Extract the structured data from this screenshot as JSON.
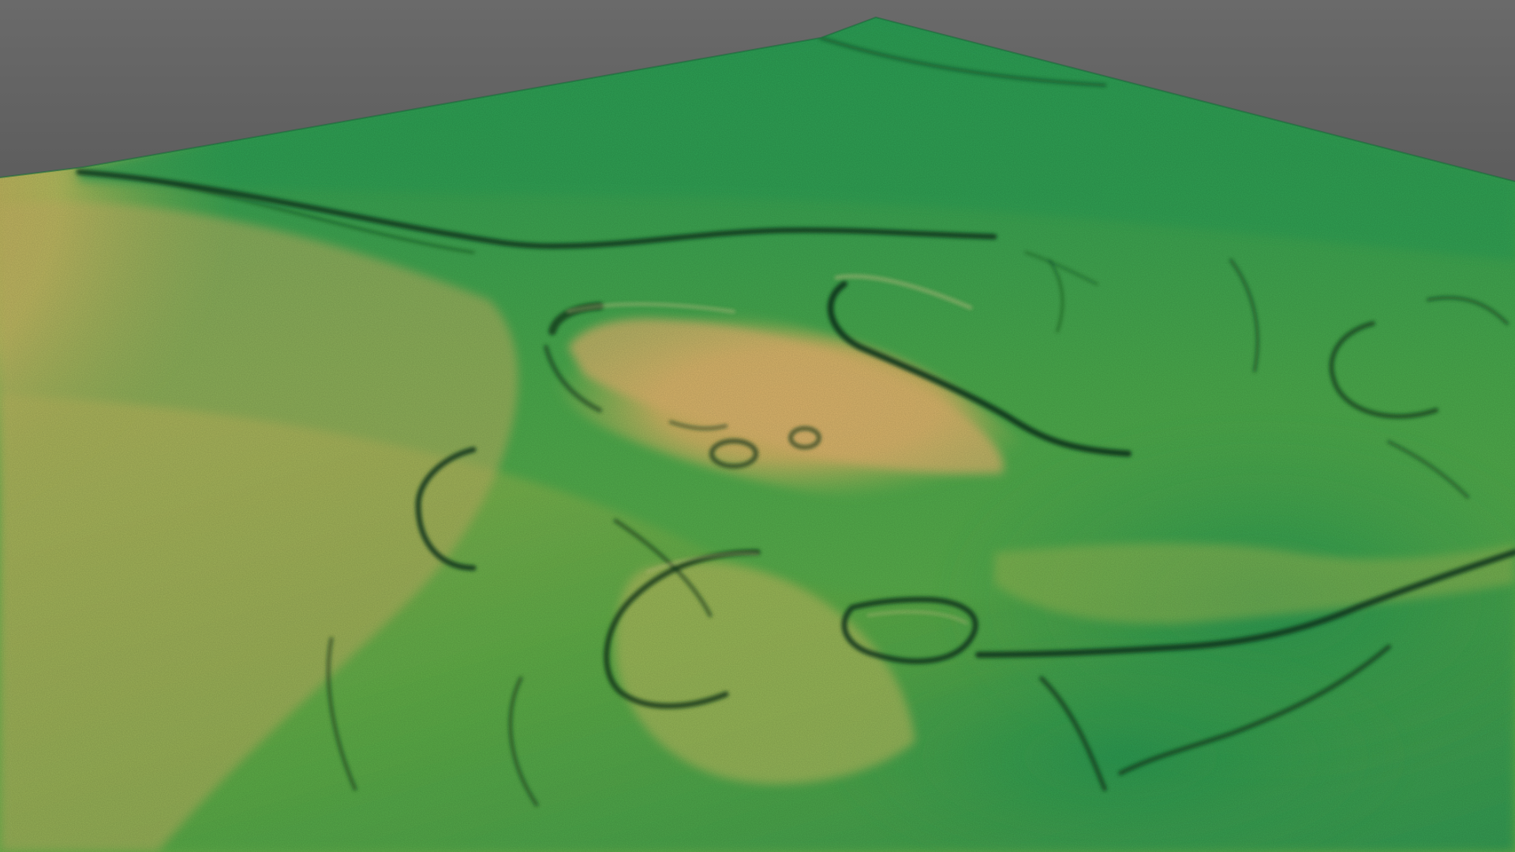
{
  "scene": {
    "kind": "3D LiDAR terrain relief render",
    "background_top_color": "#6a6a6a",
    "background_bottom_color": "#2e2e2e",
    "elevation_colormap": {
      "low": "#1f9a55",
      "mid_low": "#5cb04a",
      "mid": "#b8c060",
      "mid_high": "#d9a860",
      "high": "#d8652e"
    },
    "ridge_shadow_color": "#0e3a1c",
    "labels_visible": false
  }
}
